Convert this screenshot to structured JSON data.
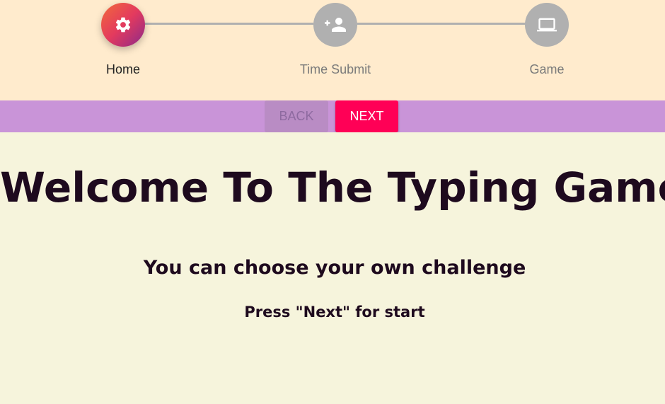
{
  "stepper": {
    "steps": [
      {
        "label": "Home",
        "icon": "gear-icon",
        "state": "active"
      },
      {
        "label": "Time Submit",
        "icon": "add-user-icon",
        "state": "inactive"
      },
      {
        "label": "Game",
        "icon": "laptop-icon",
        "state": "inactive"
      }
    ]
  },
  "navigation": {
    "back_label": "BACK",
    "next_label": "NEXT"
  },
  "main": {
    "title": "Welcome To The Typing Game",
    "subtitle": "You can choose your own challenge",
    "hint": "Press \"Next\" for start"
  },
  "colors": {
    "header_bg": "#ffebcd",
    "button_bar_bg": "#c994d8",
    "next_button": "#ff0056",
    "main_bg": "#f6f4dc",
    "text": "#1e0a1e"
  }
}
